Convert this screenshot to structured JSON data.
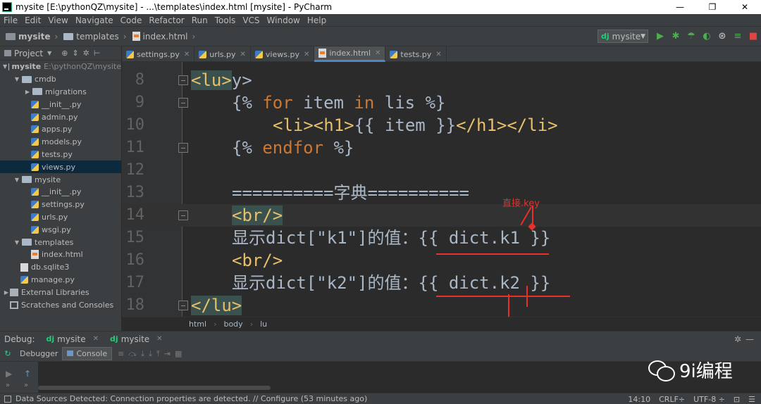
{
  "window": {
    "title": "mysite [E:\\pythonQZ\\mysite] - ...\\templates\\index.html [mysite] - PyCharm",
    "minimize": "—",
    "restore": "❐",
    "close": "✕"
  },
  "menu": [
    "File",
    "Edit",
    "View",
    "Navigate",
    "Code",
    "Refactor",
    "Run",
    "Tools",
    "VCS",
    "Window",
    "Help"
  ],
  "nav": {
    "crumbs": [
      "mysite",
      "templates",
      "index.html"
    ],
    "run_config": "mysite",
    "run_config_prefix": "dj"
  },
  "project": {
    "header": "Project",
    "tree": [
      {
        "label": "mysite",
        "sub": "E:\\pythonQZ\\mysite",
        "type": "folder",
        "depth": 0,
        "open": true
      },
      {
        "label": "cmdb",
        "type": "folder",
        "depth": 1,
        "open": true
      },
      {
        "label": "migrations",
        "type": "folder",
        "depth": 2,
        "open": false
      },
      {
        "label": "__init__.py",
        "type": "py",
        "depth": 2
      },
      {
        "label": "admin.py",
        "type": "py",
        "depth": 2
      },
      {
        "label": "apps.py",
        "type": "py",
        "depth": 2
      },
      {
        "label": "models.py",
        "type": "py",
        "depth": 2
      },
      {
        "label": "tests.py",
        "type": "py",
        "depth": 2
      },
      {
        "label": "views.py",
        "type": "py",
        "depth": 2,
        "selected": true
      },
      {
        "label": "mysite",
        "type": "folder",
        "depth": 1,
        "open": true
      },
      {
        "label": "__init__.py",
        "type": "py",
        "depth": 2
      },
      {
        "label": "settings.py",
        "type": "py",
        "depth": 2
      },
      {
        "label": "urls.py",
        "type": "py",
        "depth": 2
      },
      {
        "label": "wsgi.py",
        "type": "py",
        "depth": 2
      },
      {
        "label": "templates",
        "type": "folder",
        "depth": 1,
        "open": true
      },
      {
        "label": "index.html",
        "type": "html",
        "depth": 2
      },
      {
        "label": "db.sqlite3",
        "type": "db",
        "depth": 1
      },
      {
        "label": "manage.py",
        "type": "py",
        "depth": 1
      },
      {
        "label": "External Libraries",
        "type": "lib",
        "depth": 0,
        "open": false
      },
      {
        "label": "Scratches and Consoles",
        "type": "scratch",
        "depth": 0
      }
    ]
  },
  "tabs": [
    {
      "label": "settings.py",
      "active": false
    },
    {
      "label": "urls.py",
      "active": false
    },
    {
      "label": "views.py",
      "active": false
    },
    {
      "label": "index.html",
      "active": true
    },
    {
      "label": "tests.py",
      "active": false
    }
  ],
  "code": [
    {
      "n": "8",
      "html": "<span class=\"tagbg\">&lt;lu&gt;</span>",
      "indent": 0
    },
    {
      "n": "9",
      "html": "{% <span class=\"kw\">for</span> item <span class=\"kw\">in</span> lis %}",
      "indent": 1
    },
    {
      "n": "10",
      "html": "<span class=\"tag\">&lt;li&gt;&lt;h1&gt;</span>{{ item }}<span class=\"tag\">&lt;/h1&gt;&lt;/li&gt;</span>",
      "indent": 2
    },
    {
      "n": "11",
      "html": "{% <span class=\"kw\">endfor</span> %}",
      "indent": 1
    },
    {
      "n": "12",
      "html": "",
      "indent": 0
    },
    {
      "n": "13",
      "html": "==========字典==========",
      "indent": 1
    },
    {
      "n": "14",
      "html": "<span class=\"tagbg\">&lt;br/&gt;</span>",
      "indent": 1,
      "current": true
    },
    {
      "n": "15",
      "html": "显示dict[\"k1\"]的值：{{ dict.k1 }}",
      "indent": 1
    },
    {
      "n": "16",
      "html": "<span class=\"tag\">&lt;br/&gt;</span>",
      "indent": 1
    },
    {
      "n": "17",
      "html": "显示dict[\"k2\"]的值：{{ dict.k2 }}",
      "indent": 1
    },
    {
      "n": "18",
      "html": "<span class=\"tagbg\">&lt;/lu&gt;</span>",
      "indent": 0
    }
  ],
  "annotation_text": "直接.key",
  "breadcrumb": [
    "html",
    "body",
    "lu"
  ],
  "debug": {
    "label": "Debug:",
    "tabs": [
      "mysite",
      "mysite"
    ],
    "subtabs": [
      "Debugger",
      "Console"
    ]
  },
  "watermark": "9i编程",
  "status": {
    "message": "Data Sources Detected: Connection properties are detected. // Configure (53 minutes ago)",
    "position": "14:10",
    "line_sep": "CRLF÷",
    "encoding": "UTF-8 ÷"
  }
}
